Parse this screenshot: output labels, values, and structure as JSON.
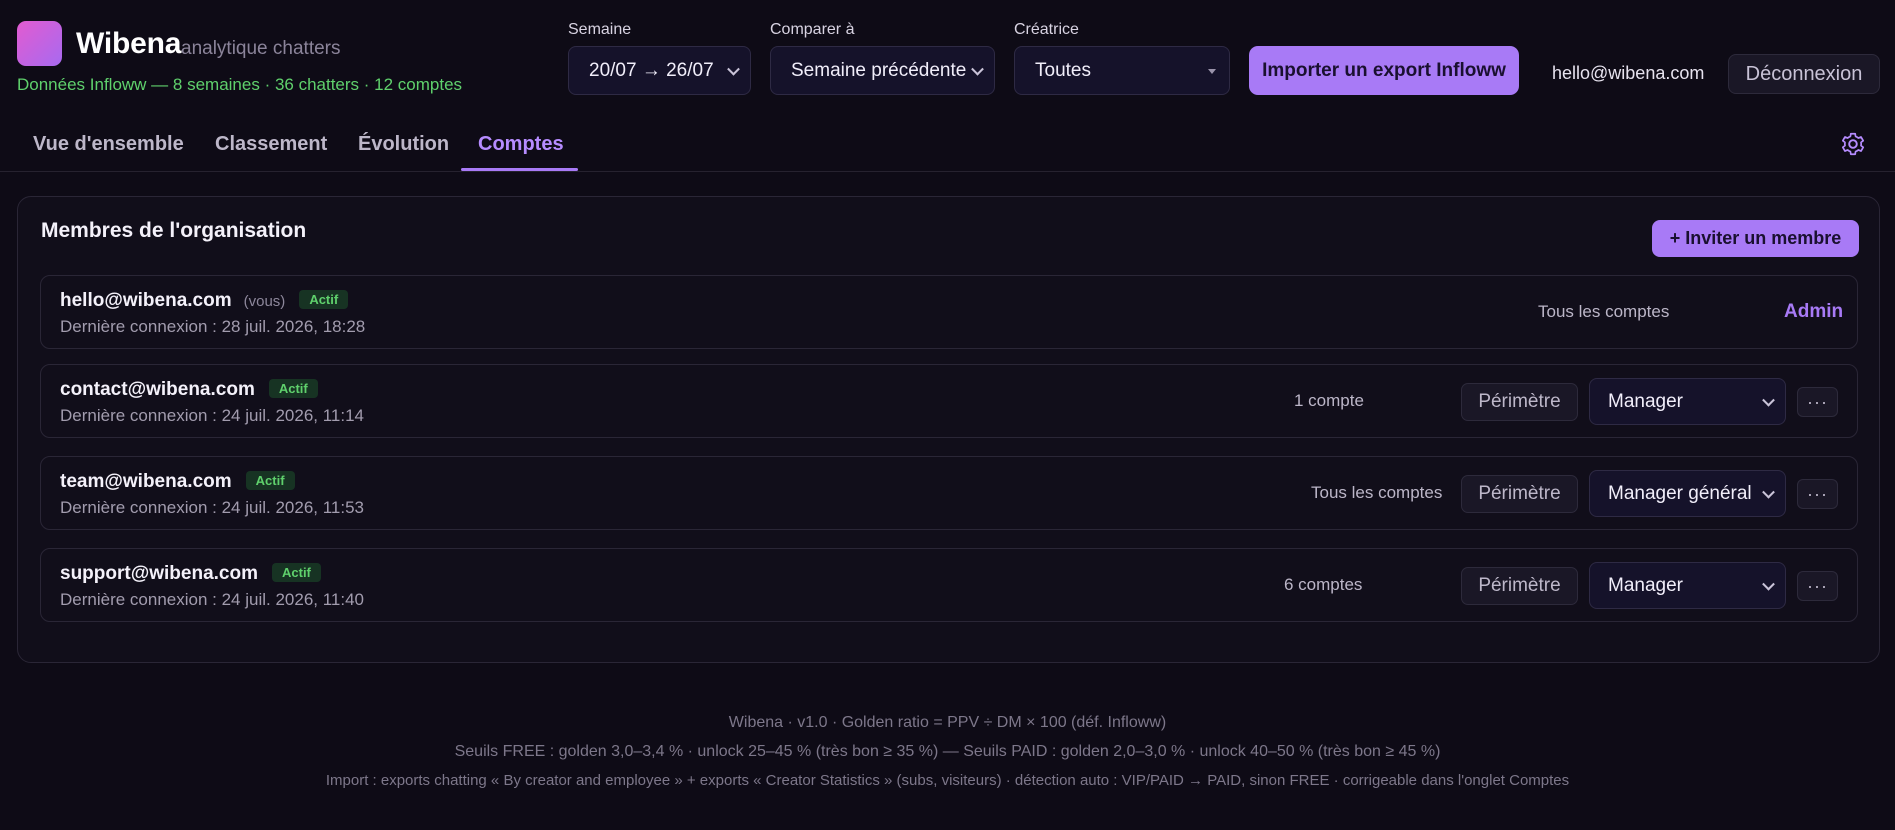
{
  "header": {
    "brand": "Wibena",
    "brand_sub": "analytique chatters",
    "data_summary": "Données Infloww — 8 semaines · 36 chatters · 12 comptes",
    "week_label": "Semaine",
    "week_value": "20/07 → 26/07",
    "compare_label": "Comparer à",
    "compare_value": "Semaine précédente",
    "creator_label": "Créatrice",
    "creator_value": "Toutes",
    "import_button": "Importer un export Infloww",
    "user_email": "hello@wibena.com",
    "logout_button": "Déconnexion"
  },
  "tabs": [
    {
      "label": "Vue d'ensemble"
    },
    {
      "label": "Classement"
    },
    {
      "label": "Évolution"
    },
    {
      "label": "Comptes"
    }
  ],
  "active_tab": "Comptes",
  "card": {
    "title": "Membres de l'organisation",
    "invite_button": "+ Inviter un membre",
    "members": [
      {
        "email": "hello@wibena.com",
        "you": "(vous)",
        "status": "Actif",
        "last_login": "Dernière connexion : 28 juil. 2026, 18:28",
        "scope": "Tous les comptes",
        "role": "Admin"
      },
      {
        "email": "contact@wibena.com",
        "status": "Actif",
        "last_login": "Dernière connexion : 24 juil. 2026, 11:14",
        "scope": "1 compte",
        "perimeter_button": "Périmètre",
        "role": "Manager",
        "more": "···"
      },
      {
        "email": "team@wibena.com",
        "status": "Actif",
        "last_login": "Dernière connexion : 24 juil. 2026, 11:53",
        "scope": "Tous les comptes",
        "perimeter_button": "Périmètre",
        "role": "Manager général",
        "more": "···"
      },
      {
        "email": "support@wibena.com",
        "status": "Actif",
        "last_login": "Dernière connexion : 24 juil. 2026, 11:40",
        "scope": "6 comptes",
        "perimeter_button": "Périmètre",
        "role": "Manager",
        "more": "···"
      }
    ]
  },
  "footer": {
    "line1": "Wibena · v1.0 · Golden ratio = PPV ÷ DM × 100 (déf. Infloww)",
    "line2": "Seuils FREE : golden 3,0–3,4 % · unlock 25–45 % (très bon ≥ 35 %) — Seuils PAID : golden 2,0–3,0 % · unlock 40–50 % (très bon ≥ 45 %)",
    "line3": "Import : exports chatting « By creator and employee » + exports « Creator Statistics » (subs, visiteurs) · détection auto : VIP/PAID → PAID, sinon FREE · corrigeable dans l'onglet Comptes"
  },
  "colors": {
    "background": "#0e0b16",
    "accent": "#a87af6",
    "success": "#5fd06c"
  }
}
